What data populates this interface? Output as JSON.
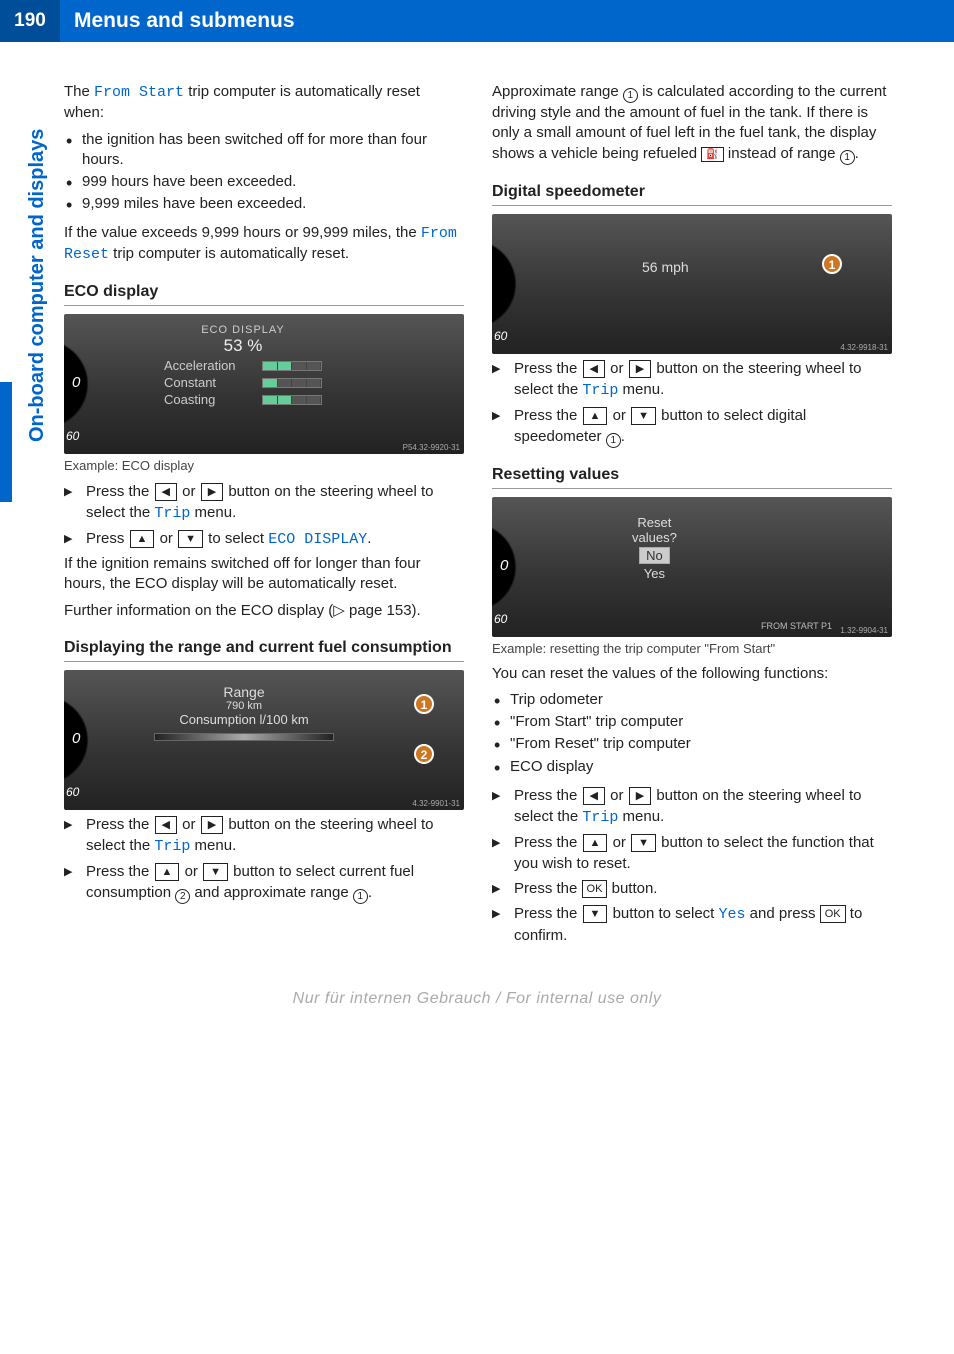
{
  "header": {
    "page_number": "190",
    "title": "Menus and submenus"
  },
  "sidebar": {
    "label": "On-board computer and displays"
  },
  "left": {
    "intro1a": "The ",
    "intro1_menu": "From Start",
    "intro1b": " trip computer is automatically reset when:",
    "bullets1": [
      "the ignition has been switched off for more than four hours.",
      "999 hours have been exceeded.",
      "9,999 miles have been exceeded."
    ],
    "intro2a": "If the value exceeds 9,999 hours or 99,999 miles, the ",
    "intro2_menu": "From Reset",
    "intro2b": " trip computer is automatically reset.",
    "eco_heading": "ECO display",
    "eco_display": {
      "title": "ECO DISPLAY",
      "pct": "53 %",
      "r1": "Acceleration",
      "r2": "Constant",
      "r3": "Coasting",
      "code": "P54.32-9920-31"
    },
    "eco_caption": "Example: ECO display",
    "eco_step1a": "Press the ",
    "eco_step1b": " or ",
    "eco_step1c": " button on the steering wheel to select the ",
    "eco_step1_menu": "Trip",
    "eco_step1d": " menu.",
    "eco_step2a": "Press ",
    "eco_step2b": " or ",
    "eco_step2c": " to select ",
    "eco_step2_menu": "ECO DISPLAY",
    "eco_step2d": ".",
    "eco_para1": "If the ignition remains switched off for longer than four hours, the ECO display will be automatically reset.",
    "eco_para2": "Further information on the ECO display (▷ page 153).",
    "range_heading": "Displaying the range and current fuel consumption",
    "range_display": {
      "title": "Range",
      "val": "790 km",
      "sub": "Consumption l/100 km",
      "code": "4.32-9901-31"
    },
    "range_step1a": "Press the ",
    "range_step1b": " or ",
    "range_step1c": " button on the steering wheel to select the ",
    "range_step1_menu": "Trip",
    "range_step1d": " menu.",
    "range_step2a": "Press the ",
    "range_step2b": " or ",
    "range_step2c": " button to select current fuel consumption ",
    "range_step2d": " and approximate range ",
    "range_step2e": "."
  },
  "right": {
    "approx1a": "Approximate range ",
    "approx1b": " is calculated according to the current driving style and the amount of fuel in the tank. If there is only a small amount of fuel left in the fuel tank, the display shows a vehicle being refueled ",
    "approx1c": " instead of range ",
    "approx1d": ".",
    "speedo_heading": "Digital speedometer",
    "speedo_display": {
      "val": "56 mph",
      "code": "4.32-9918-31"
    },
    "speedo_step1a": "Press the ",
    "speedo_step1b": " or ",
    "speedo_step1c": " button on the steering wheel to select the ",
    "speedo_step1_menu": "Trip",
    "speedo_step1d": " menu.",
    "speedo_step2a": "Press the ",
    "speedo_step2b": " or ",
    "speedo_step2c": " button to select digital speedometer ",
    "speedo_step2d": ".",
    "reset_heading": "Resetting values",
    "reset_display": {
      "title": "Reset",
      "sub": "values?",
      "no": "No",
      "yes": "Yes",
      "footer": "FROM START  P1",
      "code": "1.32-9904-31"
    },
    "reset_caption": "Example: resetting the trip computer \"From Start\"",
    "reset_intro": "You can reset the values of the following functions:",
    "reset_bullets": [
      "Trip odometer",
      "\"From Start\" trip computer",
      "\"From Reset\" trip computer",
      "ECO display"
    ],
    "reset_step1a": "Press the ",
    "reset_step1b": " or ",
    "reset_step1c": " button on the steering wheel to select the ",
    "reset_step1_menu": "Trip",
    "reset_step1d": " menu.",
    "reset_step2a": "Press the ",
    "reset_step2b": " or ",
    "reset_step2c": " button to select the function that you wish to reset.",
    "reset_step3a": "Press the ",
    "reset_step3b": " button.",
    "reset_step4a": "Press the ",
    "reset_step4b": " button to select ",
    "reset_step4_menu": "Yes",
    "reset_step4c": " and press ",
    "reset_step4d": " to confirm."
  },
  "icons": {
    "left": "◀",
    "right": "▶",
    "up": "▲",
    "down": "▼",
    "ok": "OK",
    "c1": "1",
    "c2": "2",
    "refuel": "⛽"
  },
  "gauge": {
    "t0": "0",
    "t60": "60"
  },
  "footer": "Nur für internen Gebrauch / For internal use only"
}
